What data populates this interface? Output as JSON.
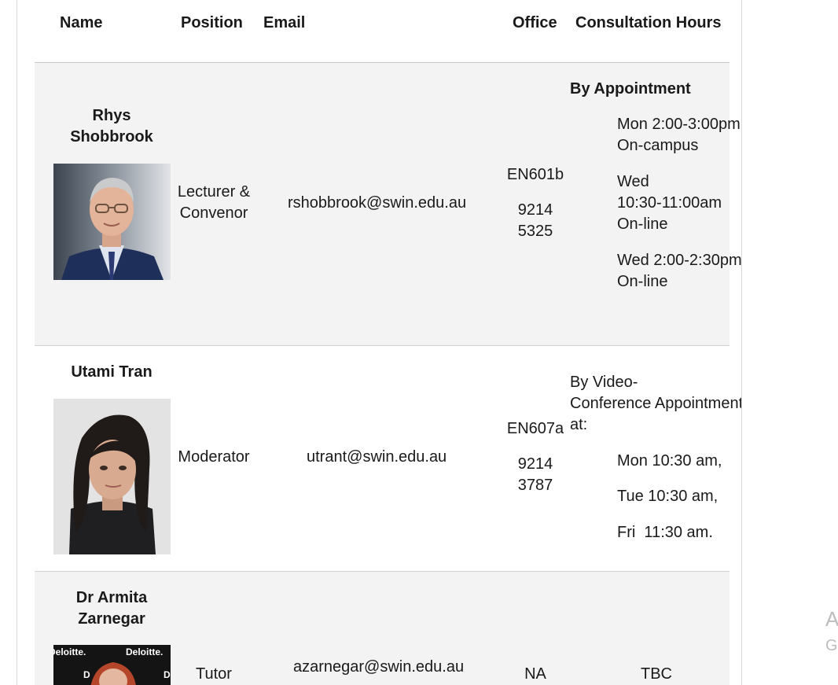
{
  "table": {
    "headers": {
      "name": "Name",
      "position": "Position",
      "email": "Email",
      "office": "Office",
      "consultation": "Consultation Hours"
    },
    "rows": [
      {
        "name": "Rhys Shobbrook",
        "name_lines": [
          "Rhys",
          "Shobbrook"
        ],
        "position_lines": [
          "Lecturer &",
          "Convenor"
        ],
        "email": "rshobbrook@swin.edu.au",
        "office": "EN601b",
        "phone_lines": [
          "9214",
          "5325"
        ],
        "consultation": {
          "heading": "By Appointment",
          "slots": [
            [
              "Mon 2:00-3:00pm",
              "On-campus"
            ],
            [
              "Wed",
              "10:30-11:00am",
              "On-line"
            ],
            [
              "Wed 2:00-2:30pm",
              "On-line"
            ]
          ]
        }
      },
      {
        "name": "Utami Tran",
        "position": "Moderator",
        "email": "utrant@swin.edu.au",
        "office": "EN607a",
        "phone_lines": [
          "9214",
          "3787"
        ],
        "consultation": {
          "intro_lines": [
            "By Video-",
            "Conference Appointment",
            "at:"
          ],
          "slots": [
            "Mon 10:30 am,",
            "Tue 10:30 am,",
            "Fri  11:30 am."
          ]
        }
      },
      {
        "name": "Dr Armita Zarnegar",
        "name_lines": [
          "Dr Armita",
          "Zarnegar"
        ],
        "position": "Tutor",
        "email": "azarnegar@swin.edu.au",
        "office": "NA",
        "consultation_text": "TBC",
        "photo_backdrop_text": "Deloitte."
      }
    ]
  },
  "side_glyphs": [
    "A",
    "G"
  ],
  "colors": {
    "row_alt_bg": "#f3f3f3",
    "rule": "#c8c8c8",
    "text": "#1a1a1a",
    "side_glyph": "#bdbdbd"
  }
}
